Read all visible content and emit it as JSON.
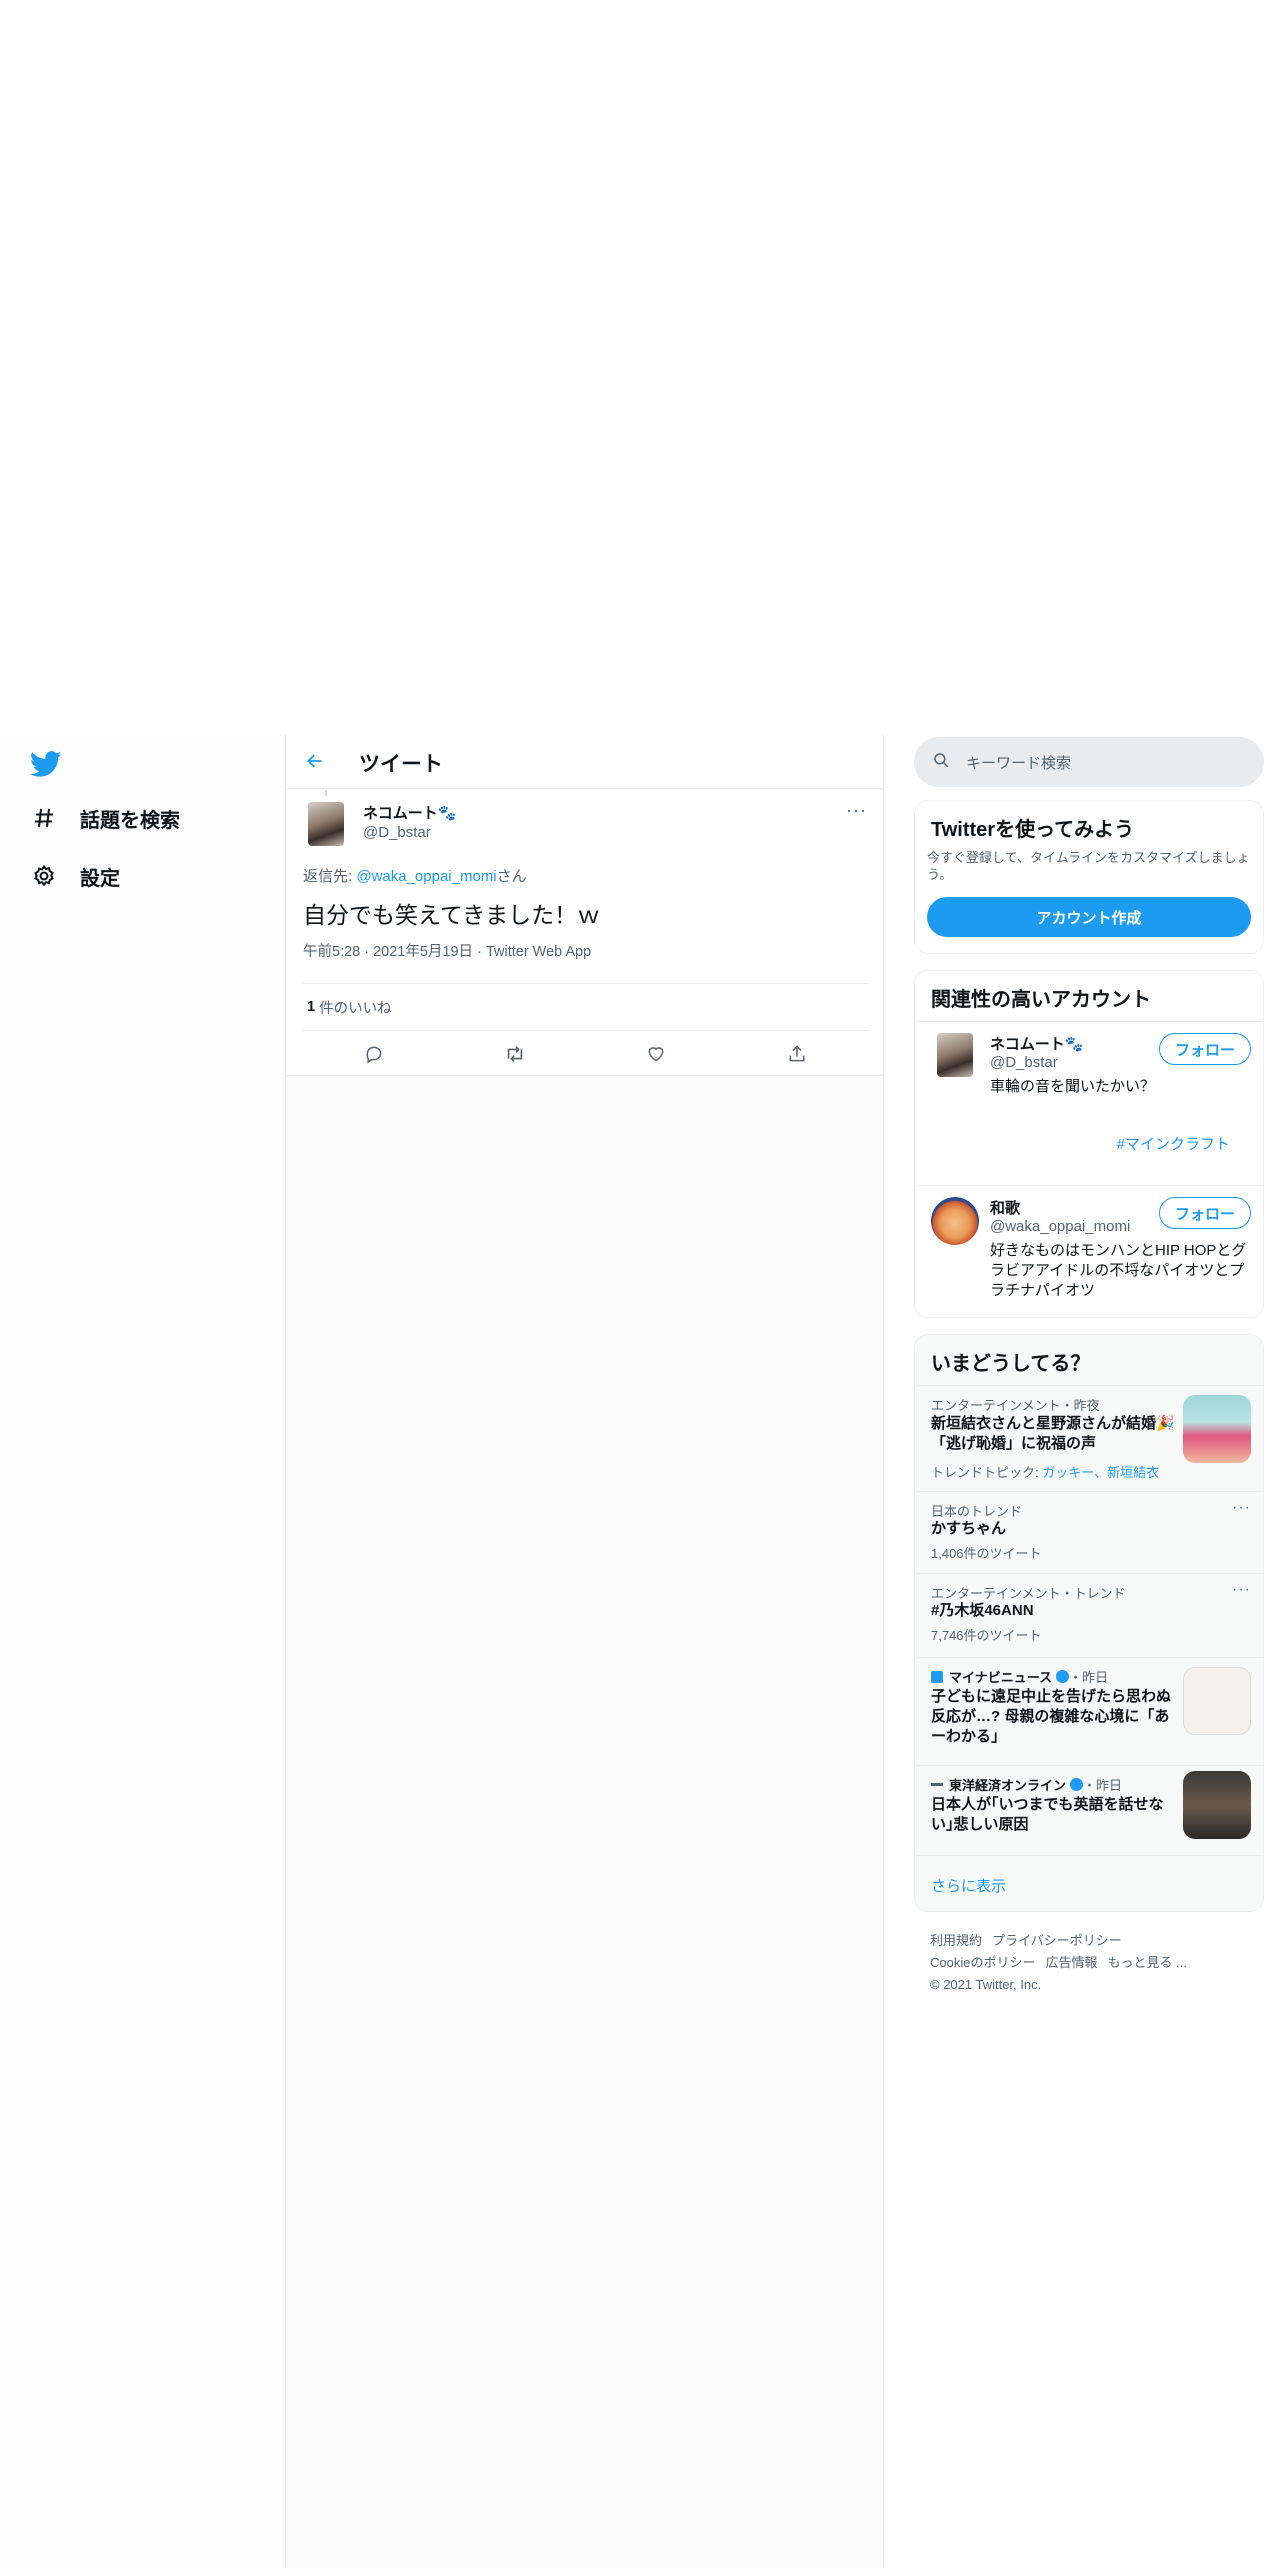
{
  "nav": {
    "logo": "twitter-bird-icon",
    "items": [
      {
        "label": "話題を検索",
        "icon": "hash-icon"
      },
      {
        "label": "設定",
        "icon": "gear-icon"
      }
    ]
  },
  "header": {
    "title": "ツイート"
  },
  "tweet": {
    "display_name": "ネコムート🐾",
    "handle": "@D_bstar",
    "reply_prefix": "返信先: ",
    "reply_user": "@waka_oppai_momi",
    "reply_suffix": "さん",
    "text": "自分でも笑えてきました！ｗ",
    "meta": "午前5:28 · 2021年5月19日 · Twitter Web App",
    "likes_count": "1",
    "likes_label": "件のいいね"
  },
  "search": {
    "placeholder": "キーワード検索"
  },
  "signup": {
    "title": "Twitterを使ってみよう",
    "subtitle": "今すぐ登録して、タイムラインをカスタマイズしましょう。",
    "button": "アカウント作成"
  },
  "relevant": {
    "title": "関連性の高いアカウント",
    "accounts": [
      {
        "name": "ネコムート🐾",
        "handle": "@D_bstar",
        "bio_line1": "車輪の音を聞いたかい？",
        "bio_tag": "#マインクラフト",
        "follow": "フォロー"
      },
      {
        "name": "和歌",
        "handle": "@waka_oppai_momi",
        "bio": "好きなものはモンハンとHIP HOPとグラビアアイドルの不埒なパイオツとプラチナパイオツ",
        "follow": "フォロー"
      }
    ]
  },
  "trends": {
    "title": "いまどうしてる？",
    "items": [
      {
        "category": "エンターテインメント・昨夜",
        "title": "新垣結衣さんと星野源さんが結婚🎉「逃げ恥婚」に祝福の声",
        "topics_label": "トレンドトピック: ",
        "topics": "ガッキー、新垣結衣"
      },
      {
        "category": "日本のトレンド",
        "title": "かすちゃん",
        "count": "1,406件のツイート"
      },
      {
        "category": "エンターテインメント・トレンド",
        "title": "#乃木坂46ANN",
        "count": "7,746件のツイート"
      },
      {
        "source": "マイナビニュース",
        "time": "・昨日",
        "title": "子どもに遠足中止を告げたら思わぬ反応が…? 母親の複雑な心境に「あーわかる」"
      },
      {
        "source": "東洋経済オンライン",
        "time": "・昨日",
        "title": "日本人が｢いつまでも英語を話せない｣悲しい原因"
      }
    ],
    "show_more": "さらに表示"
  },
  "footer": {
    "links1": [
      "利用規約",
      "プライバシーポリシー"
    ],
    "links2": [
      "Cookieのポリシー",
      "広告情報",
      "もっと見る ..."
    ],
    "copyright": "© 2021 Twitter, Inc."
  },
  "colors": {
    "accent": "#1d9bf0",
    "text": "#0f1419",
    "muted": "#536471"
  }
}
